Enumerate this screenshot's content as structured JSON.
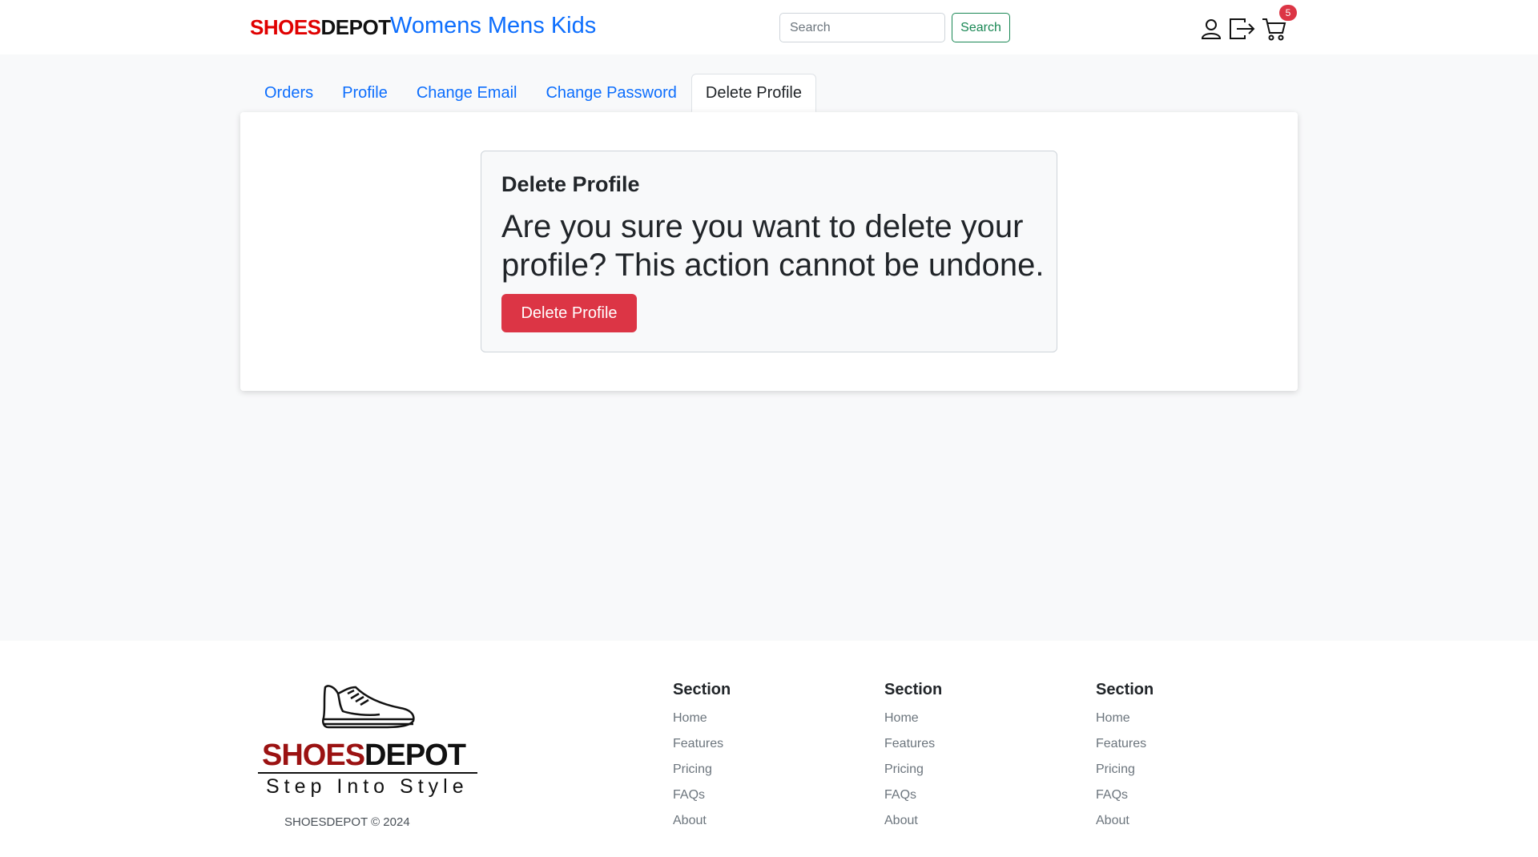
{
  "navbar": {
    "brand_red": "SHOES",
    "brand_black": "DEPOT",
    "links": [
      "Womens",
      "Mens",
      "Kids"
    ],
    "search_placeholder": "Search",
    "search_button": "Search",
    "cart_count": "5",
    "icons": [
      "user-icon",
      "logout-icon",
      "cart-icon"
    ]
  },
  "tabs": [
    {
      "label": "Orders"
    },
    {
      "label": "Profile"
    },
    {
      "label": "Change Email"
    },
    {
      "label": "Change Password"
    },
    {
      "label": "Delete Profile",
      "active": true
    }
  ],
  "delete_panel": {
    "title": "Delete Profile",
    "message": "Are you sure you want to delete your profile? This action cannot be undone.",
    "button": "Delete Profile"
  },
  "footer": {
    "logo_red": "SHOES",
    "logo_black": "DEPOT",
    "logo_tagline": "Step Into Style",
    "copyright": "SHOESDEPOT © 2024",
    "sections": [
      {
        "title": "Section",
        "links": [
          "Home",
          "Features",
          "Pricing",
          "FAQs",
          "About"
        ]
      },
      {
        "title": "Section",
        "links": [
          "Home",
          "Features",
          "Pricing",
          "FAQs",
          "About"
        ]
      },
      {
        "title": "Section",
        "links": [
          "Home",
          "Features",
          "Pricing",
          "FAQs",
          "About"
        ]
      }
    ]
  },
  "colors": {
    "brand_red": "#e00000",
    "link_blue": "#0d6efd",
    "danger": "#dc3545",
    "success": "#198754",
    "page_bg": "#f8f9fa"
  }
}
